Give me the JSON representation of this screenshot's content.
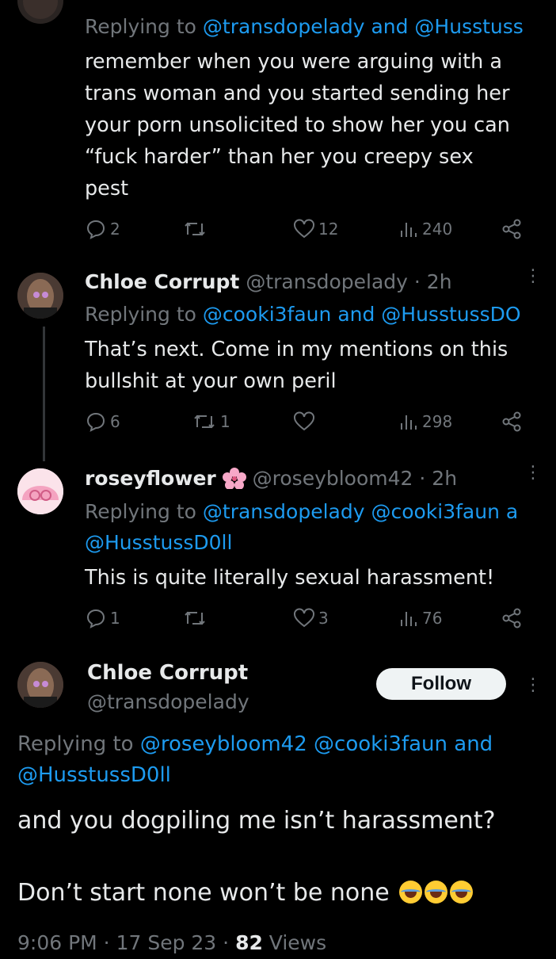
{
  "tweets": [
    {
      "name": "",
      "handle": "",
      "time": "",
      "replying_prefix": "Replying to ",
      "replying_targets": "@transdopelady and @Husstuss",
      "body_lines": [
        "remember when you were arguing with a",
        "trans woman and you started sending her",
        "your porn unsolicited to show her you can",
        "“fuck harder” than her you creepy sex",
        "pest"
      ],
      "replies": "2",
      "reposts": "",
      "likes": "12",
      "views": "240"
    },
    {
      "name": "Chloe Corrupt",
      "handle": "@transdopelady",
      "time": "· 2h",
      "replying_prefix": "Replying to ",
      "replying_targets": "@cooki3faun and @HusstussDO",
      "body_lines": [
        "That’s next. Come in my mentions on this",
        "bullshit at your own peril"
      ],
      "replies": "6",
      "reposts": "1",
      "likes": "",
      "views": "298"
    },
    {
      "name": "roseyflower",
      "handle": "@roseybloom42",
      "time": "· 2h",
      "replying_prefix": "Replying to ",
      "replying_targets": "@transdopelady @cooki3faun a",
      "replying_targets_2": "@HusstussD0ll",
      "body_lines": [
        "This is quite literally sexual harassment!"
      ],
      "replies": "1",
      "reposts": "",
      "likes": "3",
      "views": "76"
    }
  ],
  "main_tweet": {
    "name": "Chloe Corrupt",
    "handle": "@transdopelady",
    "follow_label": "Follow",
    "replying_prefix": "Replying to ",
    "replying_targets": "@roseybloom42 @cooki3faun and",
    "replying_targets_2": "@HusstussD0ll",
    "body_line_1": "and you dogpiling me isn’t harassment?",
    "body_line_2": "Don’t start none won’t be none",
    "emoji_name": "face-with-tears-of-joy",
    "time": "9:06 PM · 17 Sep 23 · ",
    "views_count": "82",
    "views_label": " Views"
  },
  "colors": {
    "background": "#000000",
    "text": "#e7e9ea",
    "muted": "#71767b",
    "link": "#1d9bf0",
    "flower": "#f7a8c8"
  }
}
